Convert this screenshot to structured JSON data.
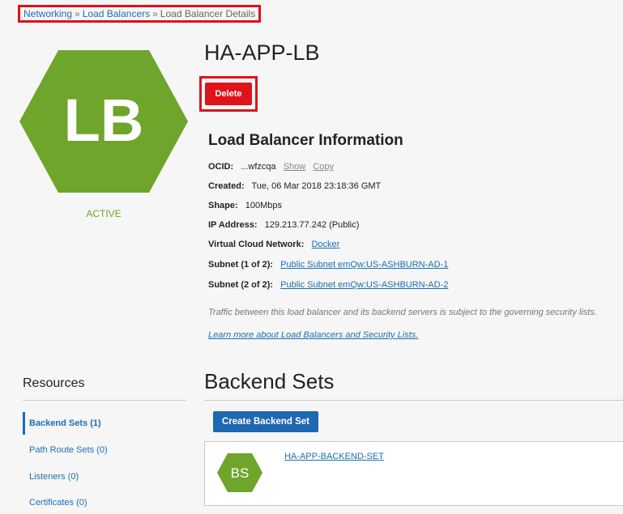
{
  "breadcrumb": {
    "items": [
      "Networking",
      "Load Balancers"
    ],
    "separator": "»",
    "current": "Load Balancer Details"
  },
  "badge": {
    "initials": "LB",
    "color": "#6ea52a",
    "status": "ACTIVE"
  },
  "title": "HA-APP-LB",
  "delete_label": "Delete",
  "info": {
    "heading": "Load Balancer Information",
    "ocid_label": "OCID:",
    "ocid_value": "...wfzcqa",
    "show_label": "Show",
    "copy_label": "Copy",
    "created_label": "Created:",
    "created_value": "Tue, 06 Mar 2018 23:18:36 GMT",
    "shape_label": "Shape:",
    "shape_value": "100Mbps",
    "ip_label": "IP Address:",
    "ip_value": "129.213.77.242 (Public)",
    "vcn_label": "Virtual Cloud Network:",
    "vcn_value": "Docker",
    "subnet1_label": "Subnet (1 of 2):",
    "subnet1_value": "Public Subnet emQw:US-ASHBURN-AD-1",
    "subnet2_label": "Subnet (2 of 2):",
    "subnet2_value": "Public Subnet emQw:US-ASHBURN-AD-2",
    "note": "Traffic between this load balancer and its backend servers is subject to the governing security lists.",
    "learn_more": "Learn more about Load Balancers and Security Lists."
  },
  "resources": {
    "title": "Resources",
    "items": [
      {
        "label": "Backend Sets (1)",
        "active": true
      },
      {
        "label": "Path Route Sets (0)",
        "active": false
      },
      {
        "label": "Listeners (0)",
        "active": false
      },
      {
        "label": "Certificates (0)",
        "active": false
      }
    ]
  },
  "backend_sets": {
    "heading": "Backend Sets",
    "create_label": "Create Backend Set",
    "items": [
      {
        "initials": "BS",
        "name": "HA-APP-BACKEND-SET"
      }
    ]
  },
  "colors": {
    "accent_blue": "#1f67b1",
    "link_blue": "#1a6fb3",
    "danger_red": "#e0121b",
    "active_green": "#6ea52a"
  }
}
